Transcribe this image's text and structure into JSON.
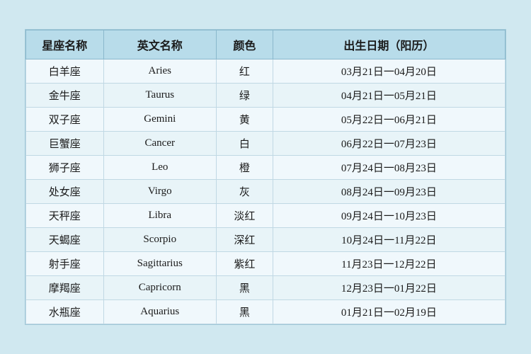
{
  "table": {
    "headers": {
      "chinese_name": "星座名称",
      "english_name": "英文名称",
      "color": "颜色",
      "birth_date": "出生日期（阳历）"
    },
    "rows": [
      {
        "chinese": "白羊座",
        "english": "Aries",
        "color": "红",
        "date": "03月21日一04月20日"
      },
      {
        "chinese": "金牛座",
        "english": "Taurus",
        "color": "绿",
        "date": "04月21日一05月21日"
      },
      {
        "chinese": "双子座",
        "english": "Gemini",
        "color": "黄",
        "date": "05月22日一06月21日"
      },
      {
        "chinese": "巨蟹座",
        "english": "Cancer",
        "color": "白",
        "date": "06月22日一07月23日"
      },
      {
        "chinese": "狮子座",
        "english": "Leo",
        "color": "橙",
        "date": "07月24日一08月23日"
      },
      {
        "chinese": "处女座",
        "english": "Virgo",
        "color": "灰",
        "date": "08月24日一09月23日"
      },
      {
        "chinese": "天秤座",
        "english": "Libra",
        "color": "淡红",
        "date": "09月24日一10月23日"
      },
      {
        "chinese": "天蝎座",
        "english": "Scorpio",
        "color": "深红",
        "date": "10月24日一11月22日"
      },
      {
        "chinese": "射手座",
        "english": "Sagittarius",
        "color": "紫红",
        "date": "11月23日一12月22日"
      },
      {
        "chinese": "摩羯座",
        "english": "Capricorn",
        "color": "黑",
        "date": "12月23日一01月22日"
      },
      {
        "chinese": "水瓶座",
        "english": "Aquarius",
        "color": "黑",
        "date": "01月21日一02月19日"
      }
    ]
  }
}
